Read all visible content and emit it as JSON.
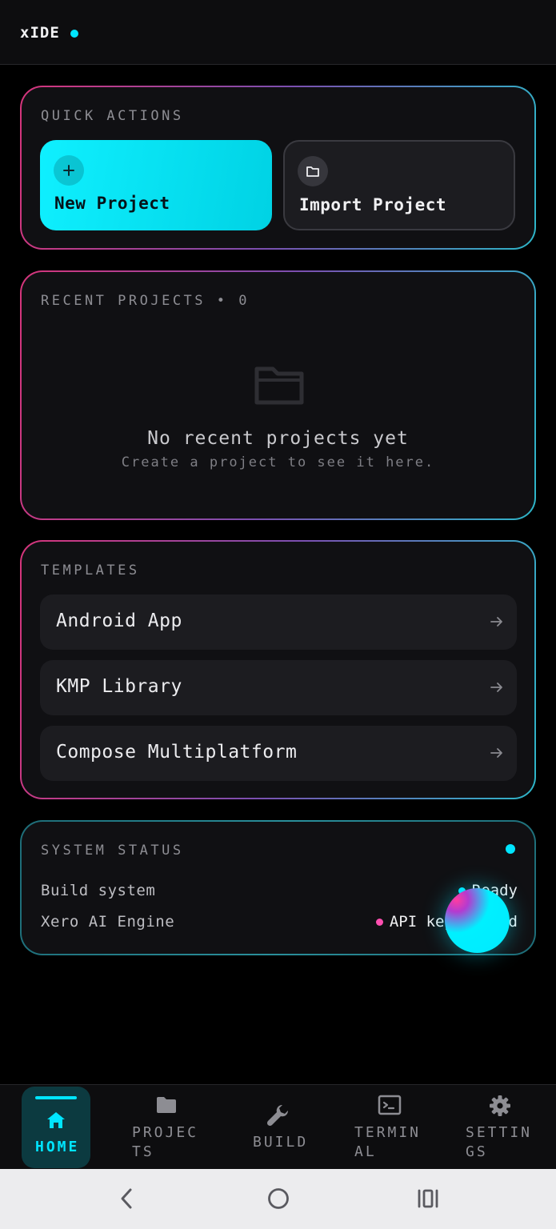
{
  "app": {
    "title": "xIDE"
  },
  "quick_actions": {
    "label": "QUICK ACTIONS",
    "new_project": {
      "label": "New Project",
      "icon": "plus-icon"
    },
    "import_project": {
      "label": "Import Project",
      "icon": "folder-icon"
    }
  },
  "recent_projects": {
    "label": "RECENT PROJECTS • 0",
    "empty_title": "No recent projects yet",
    "empty_subtitle": "Create a project to see it here.",
    "empty_icon": "folder-outline-icon"
  },
  "templates": {
    "label": "TEMPLATES",
    "items": [
      {
        "label": "Android App"
      },
      {
        "label": "KMP Library"
      },
      {
        "label": "Compose Multiplatform"
      }
    ]
  },
  "system_status": {
    "label": "SYSTEM STATUS",
    "rows": [
      {
        "name": "Build system",
        "value": "Ready",
        "dot_color": "#00e5ff"
      },
      {
        "name": "Xero AI Engine",
        "value": "API key needed",
        "dot_color": "#ff4fb0"
      }
    ]
  },
  "bottom_nav": {
    "items": [
      {
        "label": "HOME",
        "icon": "home-icon",
        "active": true
      },
      {
        "label": "PROJEC\nTS",
        "icon": "folder-icon"
      },
      {
        "label": "BUILD",
        "icon": "wrench-icon"
      },
      {
        "label": "TERMIN\nAL",
        "icon": "terminal-icon"
      },
      {
        "label": "SETTIN\nGS",
        "icon": "gear-icon"
      }
    ]
  },
  "colors": {
    "accent": "#00e5ff",
    "pink": "#ff4fb0",
    "background": "#000000",
    "card": "#101013"
  }
}
